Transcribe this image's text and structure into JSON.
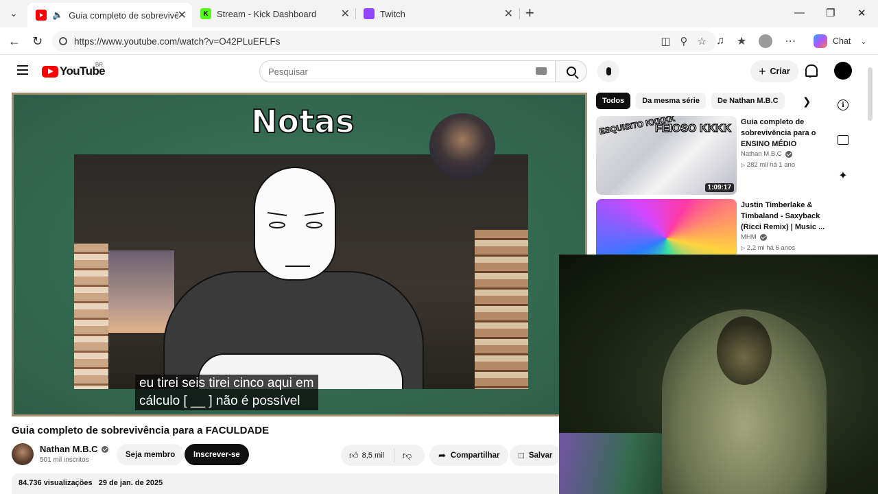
{
  "browser": {
    "tabs": [
      {
        "title": "Guia completo de sobrevivênc",
        "active": true
      },
      {
        "title": "Stream - Kick Dashboard",
        "active": false
      },
      {
        "title": "Twitch",
        "active": false
      }
    ],
    "url": "https://www.youtube.com/watch?v=O42PLuEFLFs",
    "chat_label": "Chat",
    "colors": {
      "youtube_red": "#ff0000",
      "kick_green": "#53fc18",
      "twitch_purple": "#9146ff"
    }
  },
  "youtube": {
    "logo_text": "YouTube",
    "country_code": "BR",
    "search_placeholder": "Pesquisar",
    "create_label": "Criar"
  },
  "video": {
    "overlay_title": "Notas",
    "subtitle_line1": "eu tirei seis tirei cinco aqui em",
    "subtitle_line2": "cálculo [ __ ] não é possível",
    "title": "Guia completo de sobrevivência para a FACULDADE",
    "channel": "Nathan M.B.C",
    "subscribers": "501 mil inscritos",
    "join_label": "Seja membro",
    "subscribe_label": "Inscrever-se",
    "likes": "8,5 mil",
    "share_label": "Compartilhar",
    "save_label": "Salvar",
    "views": "84.736 visualizações",
    "date": "29 de jan. de 2025"
  },
  "sidebar": {
    "chips": [
      "Todos",
      "Da mesma série",
      "De Nathan M.B.C"
    ],
    "recommendations": [
      {
        "title": "Guia completo de sobrevivência para o ENSINO MÉDIO",
        "channel": "Nathan M.B.C",
        "meta": "282 mil  há 1 ano",
        "duration": "1:09:17",
        "thumb_text1": "ESQUISITO KKKKK",
        "thumb_text2": "FEIOSO KKKK"
      },
      {
        "title": "Justin Timberlake & Timbaland - Saxyback (Ricci Remix) | Music ...",
        "channel": "MHM",
        "meta": "2,2 mi  há 6 anos",
        "duration": ""
      }
    ]
  }
}
